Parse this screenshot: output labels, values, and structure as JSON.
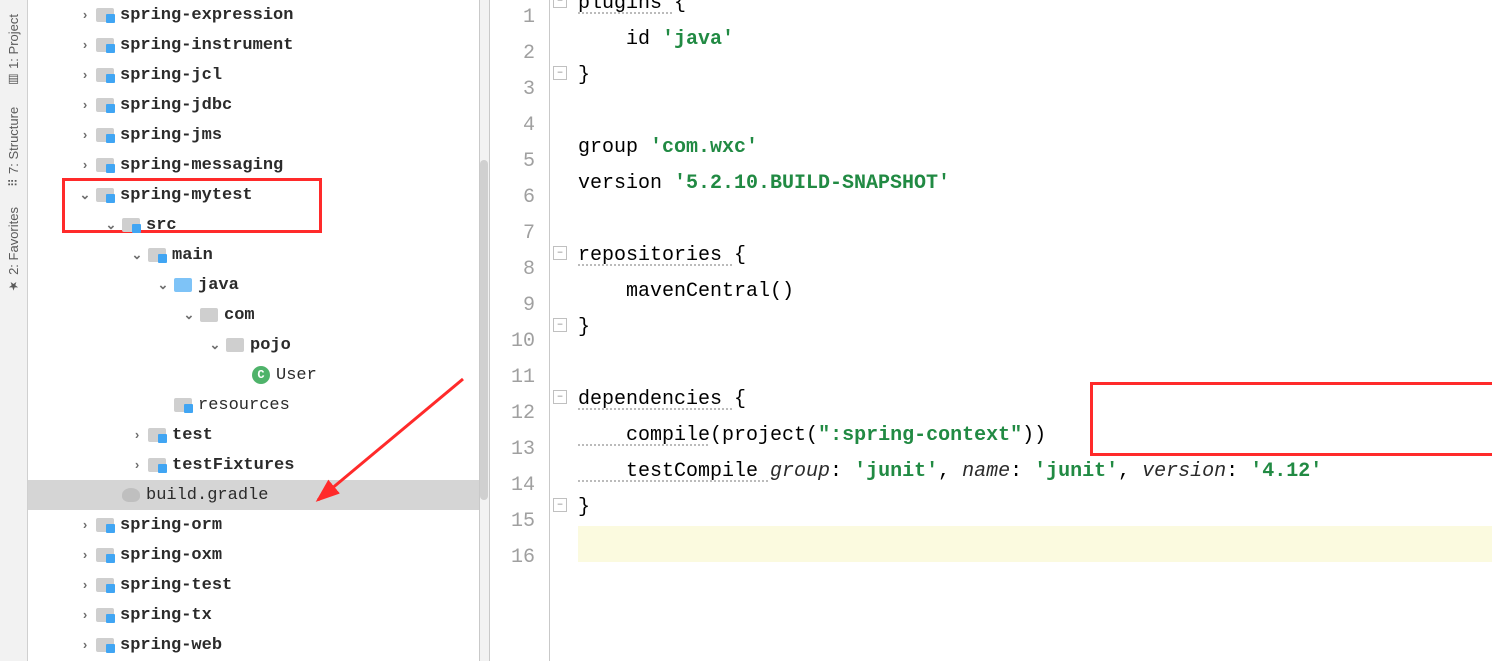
{
  "sidebar_tabs": {
    "project": "1: Project",
    "structure": "7: Structure",
    "favorites": "2: Favorites"
  },
  "tree": {
    "spring_expression": "spring-expression",
    "spring_instrument": "spring-instrument",
    "spring_jcl": "spring-jcl",
    "spring_jdbc": "spring-jdbc",
    "spring_jms": "spring-jms",
    "spring_messaging": "spring-messaging",
    "spring_mytest": "spring-mytest",
    "src": "src",
    "main": "main",
    "java": "java",
    "com": "com",
    "pojo": "pojo",
    "user": "User",
    "resources": "resources",
    "test": "test",
    "testFixtures": "testFixtures",
    "build_gradle": "build.gradle",
    "spring_orm": "spring-orm",
    "spring_oxm": "spring-oxm",
    "spring_test": "spring-test",
    "spring_tx": "spring-tx",
    "spring_web": "spring-web"
  },
  "code": {
    "l1a": "plugins ",
    "l1b": "{",
    "l2a": "    id ",
    "l2b": "'java'",
    "l3": "}",
    "l5a": "group ",
    "l5b": "'com.wxc'",
    "l6a": "version ",
    "l6b": "'5.2.10.BUILD-SNAPSHOT'",
    "l8a": "repositories ",
    "l8b": "{",
    "l9": "    mavenCentral()",
    "l10": "}",
    "l12a": "dependencies ",
    "l12b": "{",
    "l13a": "    compile",
    "l13b": "(project(",
    "l13c": "\":spring-context\"",
    "l13d": "))",
    "l14a": "    testCompile ",
    "l14b": "group",
    "l14c": ": ",
    "l14d": "'junit'",
    "l14e": ", ",
    "l14f": "name",
    "l14g": ": ",
    "l14h": "'junit'",
    "l14i": ", ",
    "l14j": "version",
    "l14k": ": ",
    "l14l": "'4.12'",
    "l15": "}"
  },
  "line_numbers": [
    "1",
    "2",
    "3",
    "4",
    "5",
    "6",
    "7",
    "8",
    "9",
    "10",
    "11",
    "12",
    "13",
    "14",
    "15",
    "16"
  ]
}
